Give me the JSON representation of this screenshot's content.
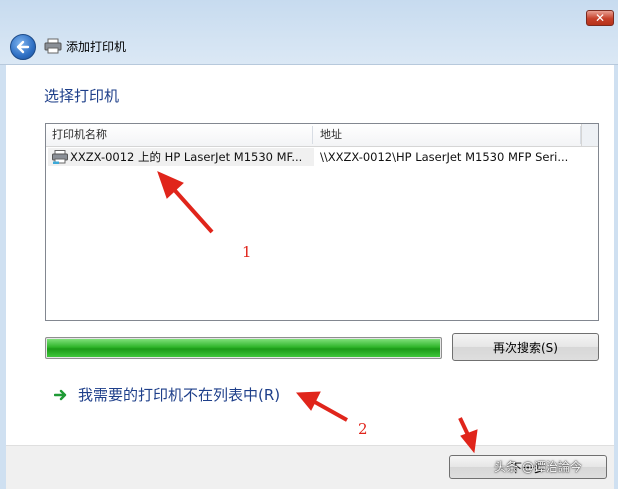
{
  "window": {
    "title": "添加打印机",
    "close_glyph": "✕"
  },
  "heading": "选择打印机",
  "table": {
    "columns": [
      "打印机名称",
      "地址"
    ],
    "rows": [
      {
        "name": "XXZX-0012 上的 HP LaserJet M1530 MF...",
        "address": "\\\\XXZX-0012\\HP LaserJet M1530 MFP Seri..."
      }
    ]
  },
  "progress": {
    "value": 1.0,
    "color": "#2fb52a"
  },
  "buttons": {
    "search_again": "再次搜索(S)",
    "next": "下一步"
  },
  "link": "我需要的打印机不在列表中(R)",
  "annotations": {
    "label1": "1",
    "label2": "2",
    "watermark": "头条 @谭治論今",
    "color": "#e0251b"
  },
  "icons": {
    "back": "back-arrow-icon",
    "printer": "printer-icon",
    "link_arrow": "green-arrow-icon"
  }
}
